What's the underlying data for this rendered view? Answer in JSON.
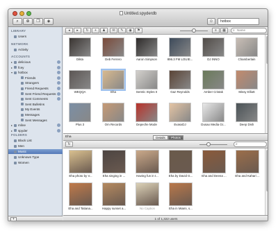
{
  "window": {
    "title": "Untitled.spyderdb"
  },
  "toolbar": {
    "search_value": "hotbox",
    "buttons": [
      "search-icon",
      "add-user-icon",
      "bookmark-icon",
      "tag-icon"
    ]
  },
  "sidebar": {
    "sections": {
      "library": "LIBRARY",
      "network": "NETWORK",
      "accounts": "ACCOUNTS",
      "folders": "FOLDERS"
    },
    "library_items": [
      {
        "label": "Users"
      }
    ],
    "network_items": [
      {
        "label": "Activity"
      }
    ],
    "account_items": [
      {
        "label": "delicious",
        "indent": 1,
        "tri": "▸"
      },
      {
        "label": "fcey",
        "indent": 1,
        "tri": "▸"
      },
      {
        "label": "hotbox",
        "indent": 1,
        "tri": "▾"
      },
      {
        "label": "Friends",
        "indent": 2,
        "tri": ""
      },
      {
        "label": "Strangers",
        "indent": 2,
        "tri": ""
      },
      {
        "label": "Friend Requests",
        "indent": 2,
        "tri": ""
      },
      {
        "label": "Sent Friend Requests",
        "indent": 2,
        "tri": ""
      },
      {
        "label": "Sent Comments",
        "indent": 2,
        "tri": ""
      },
      {
        "label": "Sent Bulletins",
        "indent": 2,
        "tri": ""
      },
      {
        "label": "My Events",
        "indent": 2,
        "tri": ""
      },
      {
        "label": "Messages",
        "indent": 2,
        "tri": ""
      },
      {
        "label": "Sent Messages",
        "indent": 2,
        "tri": ""
      },
      {
        "label": "mline",
        "indent": 1,
        "tri": "▸"
      },
      {
        "label": "spyder",
        "indent": 1,
        "tri": "▸"
      }
    ],
    "folder_items": [
      {
        "label": "Black List",
        "selected": false
      },
      {
        "label": "Men",
        "selected": false
      },
      {
        "label": "Music",
        "selected": true
      },
      {
        "label": "Unknown Type",
        "selected": false
      },
      {
        "label": "Women",
        "selected": false
      }
    ]
  },
  "main": {
    "top_search_placeholder": "Name",
    "users": [
      {
        "name": "Dikta",
        "color": "#3a3532"
      },
      {
        "name": "Deb Ferrero",
        "color": "#7a4a3a"
      },
      {
        "name": "Aaron Simpson",
        "color": "#2e2b2a"
      },
      {
        "name": "896.3 FM LOUIE...",
        "color": "#3d4a5a"
      },
      {
        "name": "DJ INNO",
        "color": "#514c48"
      },
      {
        "name": "Chamberlain",
        "color": "#c9bfb6"
      },
      {
        "name": "WEQQA",
        "color": "#5c5654"
      },
      {
        "name": "Eha",
        "color": "#d8b98f"
      },
      {
        "name": "Sentric Styles II",
        "color": "#d3d0cc"
      },
      {
        "name": "Gaz Reynolds",
        "color": "#5a4436"
      },
      {
        "name": "Amber Cristak",
        "color": "#6a7a5a"
      },
      {
        "name": "Missy Elliott",
        "color": "#c28a6d"
      },
      {
        "name": "Plus 3",
        "color": "#7b8fa5"
      },
      {
        "name": "Om Records",
        "color": "#c69a75"
      },
      {
        "name": "Depeche Mode",
        "color": "#b8322a"
      },
      {
        "name": "EvasxDJ",
        "color": "#e4c4a4"
      },
      {
        "name": "Dusao Media Gr...",
        "color": "#e8e8e8"
      },
      {
        "name": "Deep Dish",
        "color": "#4a5256"
      }
    ],
    "selected_user": "Eha",
    "tabs": [
      "Details",
      "Photos"
    ],
    "active_tab": "Photos",
    "photos": [
      {
        "caption": "Eha photo by V...",
        "color": "#d9c08f",
        "muted": false
      },
      {
        "caption": "Eha singing in ...",
        "color": "#4d4542",
        "muted": false
      },
      {
        "caption": "Having fun in t...",
        "color": "#caa98a",
        "muted": false
      },
      {
        "caption": "Eha by David G...",
        "color": "#6a5a4a",
        "muted": false
      },
      {
        "caption": "Eha and Deena ...",
        "color": "#8a5a3a",
        "muted": false
      },
      {
        "caption": "Eha and Kahari ...",
        "color": "#9b6e4a",
        "muted": false
      },
      {
        "caption": "Eha and Tatiana...",
        "color": "#c07a4a",
        "muted": false
      },
      {
        "caption": "Happy sunset a...",
        "color": "#b58a60",
        "muted": false
      },
      {
        "caption": "No Caption",
        "color": "#dcd2b8",
        "muted": true
      },
      {
        "caption": "Eha in Miami, s...",
        "color": "#b9784a",
        "muted": false
      }
    ],
    "status": "1 of 1,322 users"
  }
}
